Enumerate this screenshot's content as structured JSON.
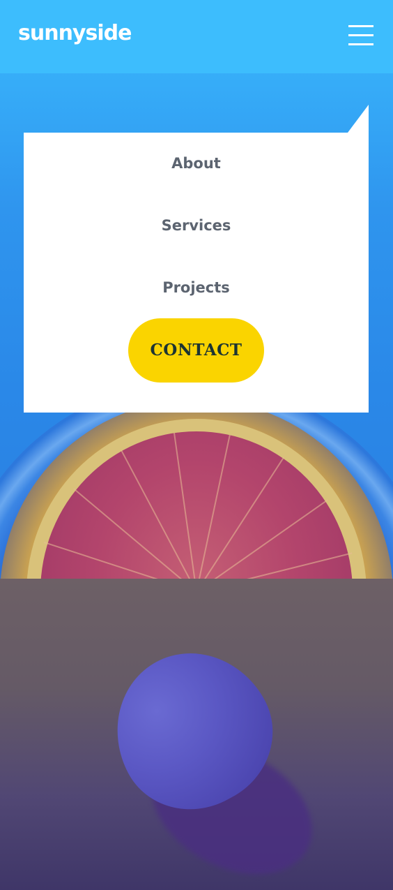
{
  "header": {
    "logo_text": "sunnyside",
    "menu_icon": "hamburger-menu-icon"
  },
  "nav": {
    "links": [
      {
        "label": "About"
      },
      {
        "label": "Services"
      },
      {
        "label": "Projects"
      }
    ],
    "contact_label": "CONTACT"
  },
  "colors": {
    "header_blue": "#3dbdfd",
    "panel_white": "#ffffff",
    "nav_text": "#5c6470",
    "contact_yellow": "#fad400",
    "contact_text": "#1c3432"
  },
  "images": {
    "hero": "grapefruit-half-image",
    "lower": "egg-on-surface-image"
  }
}
